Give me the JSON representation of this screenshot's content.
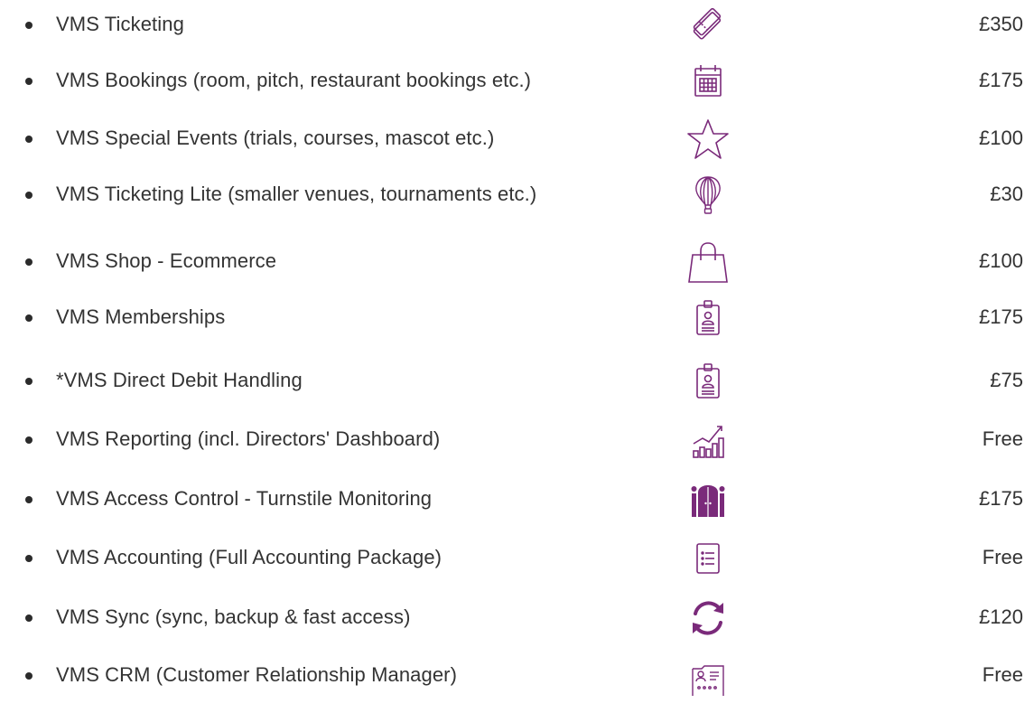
{
  "colors": {
    "icon": "#7a2a7a",
    "text": "#333333",
    "bullet": "#2b2b2b"
  },
  "items": [
    {
      "label": "VMS Ticketing",
      "icon": "ticket-icon",
      "price": "£350"
    },
    {
      "label": "VMS Bookings (room, pitch, restaurant bookings etc.)",
      "icon": "calendar-icon",
      "price": "£175"
    },
    {
      "label": "VMS Special Events (trials, courses, mascot etc.)",
      "icon": "star-icon",
      "price": "£100"
    },
    {
      "label": "VMS Ticketing Lite (smaller venues, tournaments etc.)",
      "icon": "hot-air-balloon-icon",
      "price": "£30"
    },
    {
      "label": "VMS Shop - Ecommerce",
      "icon": "shopping-bag-icon",
      "price": "£100"
    },
    {
      "label": "VMS Memberships",
      "icon": "id-badge-icon",
      "price": "£175"
    },
    {
      "label": "*VMS Direct Debit Handling",
      "icon": "id-badge-icon",
      "price": "£75"
    },
    {
      "label": "VMS Reporting (incl. Directors' Dashboard)",
      "icon": "bar-chart-trend-icon",
      "price": "Free"
    },
    {
      "label": "VMS Access Control - Turnstile Monitoring",
      "icon": "gate-icon",
      "price": "£175"
    },
    {
      "label": "VMS Accounting (Full Accounting Package)",
      "icon": "list-document-icon",
      "price": "Free"
    },
    {
      "label": "VMS Sync (sync, backup & fast access)",
      "icon": "sync-icon",
      "price": "£120"
    },
    {
      "label": "VMS CRM (Customer Relationship Manager)",
      "icon": "contact-folder-icon",
      "price": "Free"
    }
  ]
}
